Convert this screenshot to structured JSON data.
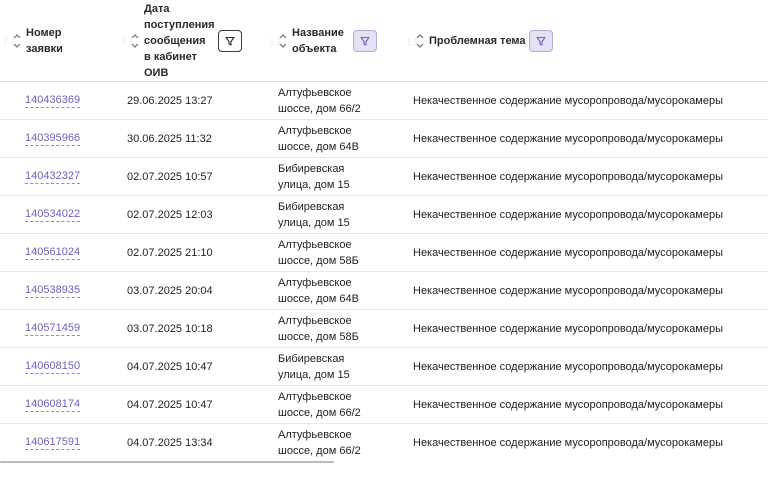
{
  "columns": {
    "number": "Номер\nзаявки",
    "date": "Дата\nпоступления\nсообщения\nв кабинет\nОИВ",
    "object": "Название\nобъекта",
    "topic": "Проблемная тема"
  },
  "rows": [
    {
      "id": "140436369",
      "date": "29.06.2025 13:27",
      "object": "Алтуфьевское\nшоссе, дом 66/2",
      "topic": "Некачественное содержание мусоропровода/мусорокамеры"
    },
    {
      "id": "140395966",
      "date": "30.06.2025 11:32",
      "object": "Алтуфьевское\nшоссе, дом 64В",
      "topic": "Некачественное содержание мусоропровода/мусорокамеры"
    },
    {
      "id": "140432327",
      "date": "02.07.2025 10:57",
      "object": "Бибиревская\nулица, дом 15",
      "topic": "Некачественное содержание мусоропровода/мусорокамеры"
    },
    {
      "id": "140534022",
      "date": "02.07.2025 12:03",
      "object": "Бибиревская\nулица, дом 15",
      "topic": "Некачественное содержание мусоропровода/мусорокамеры"
    },
    {
      "id": "140561024",
      "date": "02.07.2025 21:10",
      "object": "Алтуфьевское\nшоссе, дом 58Б",
      "topic": "Некачественное содержание мусоропровода/мусорокамеры"
    },
    {
      "id": "140538935",
      "date": "03.07.2025 20:04",
      "object": "Алтуфьевское\nшоссе, дом 64В",
      "topic": "Некачественное содержание мусоропровода/мусорокамеры"
    },
    {
      "id": "140571459",
      "date": "03.07.2025 10:18",
      "object": "Алтуфьевское\nшоссе, дом 58Б",
      "topic": "Некачественное содержание мусоропровода/мусорокамеры"
    },
    {
      "id": "140608150",
      "date": "04.07.2025 10:47",
      "object": "Бибиревская\nулица, дом 15",
      "topic": "Некачественное содержание мусоропровода/мусорокамеры"
    },
    {
      "id": "140608174",
      "date": "04.07.2025 10:47",
      "object": "Алтуфьевское\nшоссе, дом 66/2",
      "topic": "Некачественное содержание мусоропровода/мусорокамеры"
    },
    {
      "id": "140617591",
      "date": "04.07.2025 13:34",
      "object": "Алтуфьевское\nшоссе, дом 66/2",
      "topic": "Некачественное содержание мусоропровода/мусорокамеры"
    }
  ],
  "icons": {
    "drag": "drag-handle-icon",
    "sort": "sort-arrows-icon",
    "filter": "filter-funnel-icon"
  },
  "colors": {
    "link": "#6b63b8",
    "filter_active_bg": "#e4e1f5",
    "filter_active_border": "#b3acd8"
  }
}
